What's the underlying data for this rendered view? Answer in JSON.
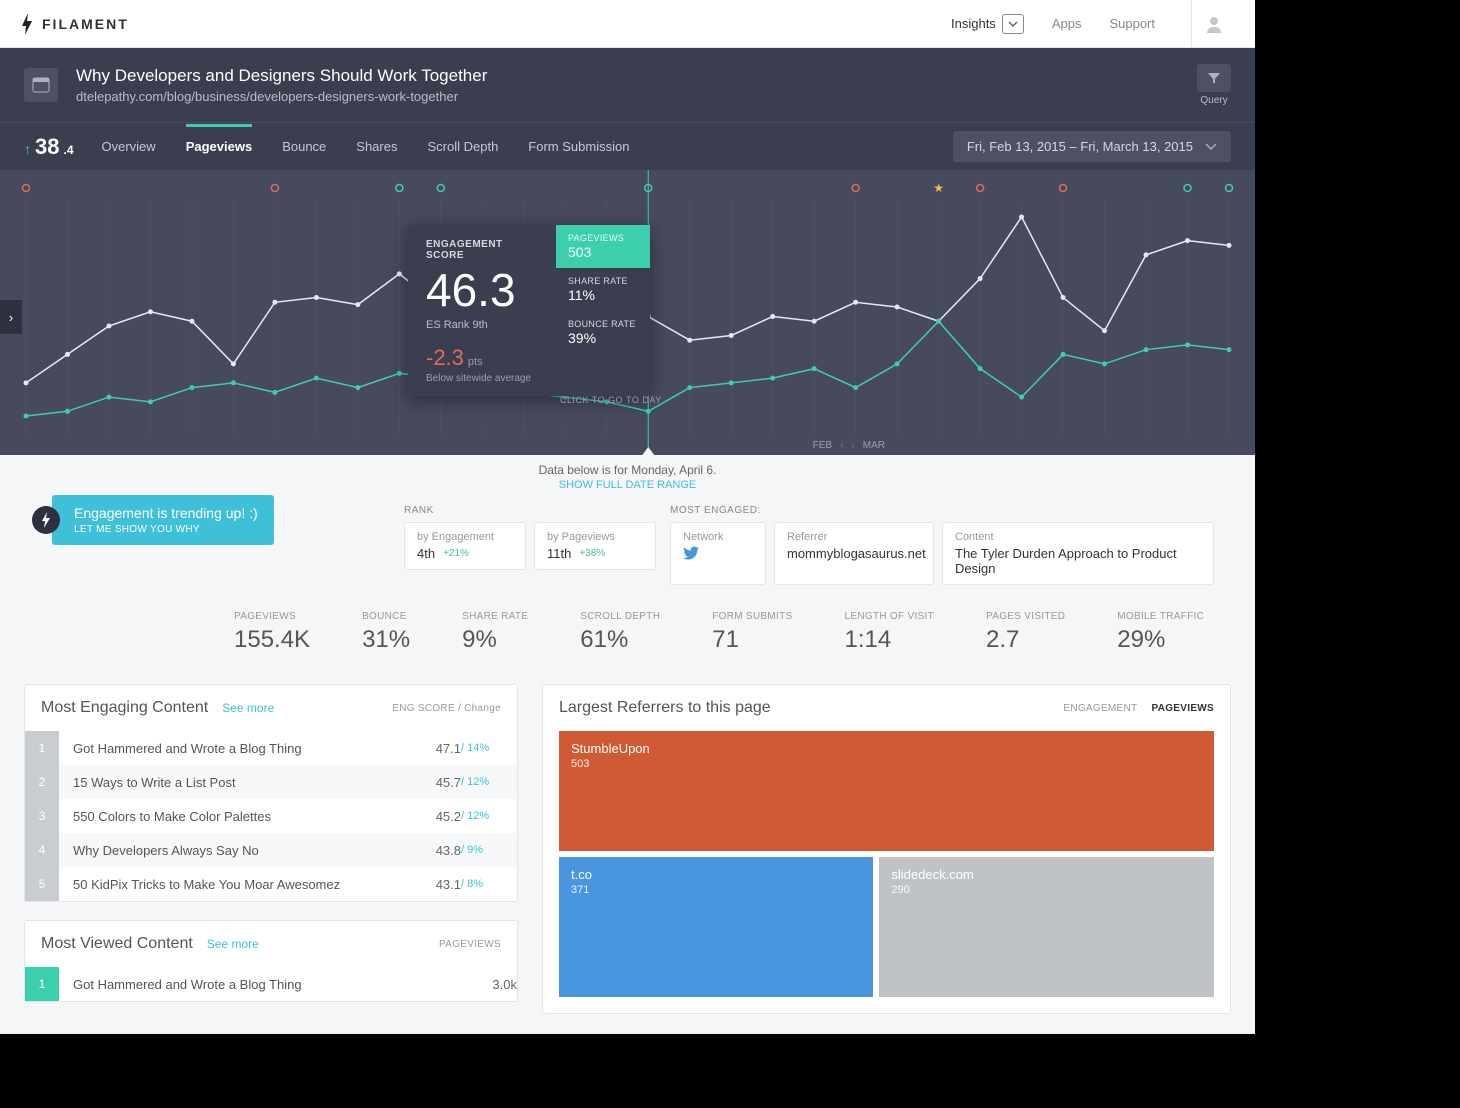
{
  "brand": "FILAMENT",
  "nav": {
    "insights": "Insights",
    "apps": "Apps",
    "support": "Support"
  },
  "page": {
    "title": "Why Developers and Designers Should Work Together",
    "url": "dtelepathy.com/blog/business/developers-designers-work-together",
    "query": "Query"
  },
  "score": {
    "int": "38",
    "dec": ".4"
  },
  "tabs": {
    "overview": "Overview",
    "pageviews": "Pageviews",
    "bounce": "Bounce",
    "shares": "Shares",
    "scroll": "Scroll Depth",
    "form": "Form Submission"
  },
  "daterange": "Fri, Feb 13, 2015 – Fri, March 13, 2015",
  "tooltip": {
    "title": "ENGAGEMENT SCORE",
    "score": "46.3",
    "rank": "ES Rank 9th",
    "delta": "-2.3",
    "delta_unit": "pts",
    "below": "Below sitewide average",
    "pv_lbl": "PAGEVIEWS",
    "pv_val": "503",
    "sr_lbl": "SHARE RATE",
    "sr_val": "11%",
    "br_lbl": "BOUNCE RATE",
    "br_val": "39%",
    "hint": "CLICK TO GO TO DAY"
  },
  "months": {
    "feb": "FEB",
    "mar": "MAR"
  },
  "databar": {
    "text": "Data below is for Monday, April 6.",
    "link": "SHOW FULL DATE RANGE"
  },
  "trend": {
    "t": "Engagement is trending up!  :)",
    "s": "LET ME SHOW YOU WHY"
  },
  "rank": {
    "lbl": "RANK",
    "by_eng_lbl": "by Engagement",
    "by_eng_val": "4th",
    "by_eng_pct": "+21%",
    "by_pv_lbl": "by Pageviews",
    "by_pv_val": "11th",
    "by_pv_pct": "+38%"
  },
  "engaged": {
    "lbl": "MOST ENGAGED:",
    "net_lbl": "Network",
    "ref_lbl": "Referrer",
    "ref_val": "mommyblogasaurus.net",
    "con_lbl": "Content",
    "con_val": "The Tyler Durden Approach to Product Design"
  },
  "metrics": {
    "pv": {
      "l": "PAGEVIEWS",
      "v": "155.4K"
    },
    "bn": {
      "l": "BOUNCE",
      "v": "31%"
    },
    "sr": {
      "l": "SHARE RATE",
      "v": "9%"
    },
    "sd": {
      "l": "SCROLL DEPTH",
      "v": "61%"
    },
    "fs": {
      "l": "FORM SUBMITS",
      "v": "71"
    },
    "lv": {
      "l": "LENGTH OF VISIT",
      "v": "1:14"
    },
    "pvs": {
      "l": "PAGES VISITED",
      "v": "2.7"
    },
    "mt": {
      "l": "MOBILE TRAFFIC",
      "v": "29%"
    }
  },
  "engaging": {
    "title": "Most Engaging Content",
    "more": "See more",
    "meta": "ENG SCORE / Change",
    "rows": [
      {
        "n": "1",
        "t": "Got Hammered and Wrote a Blog Thing",
        "v": "47.1",
        "c": "/ 14%"
      },
      {
        "n": "2",
        "t": "15 Ways to Write a List Post",
        "v": "45.7",
        "c": "/ 12%"
      },
      {
        "n": "3",
        "t": "550 Colors to Make Color Palettes",
        "v": "45.2",
        "c": "/ 12%"
      },
      {
        "n": "4",
        "t": "Why Developers Always Say No",
        "v": "43.8",
        "c": "/ 9%"
      },
      {
        "n": "5",
        "t": "50 KidPix Tricks to Make You Moar Awesomez",
        "v": "43.1",
        "c": "/ 8%"
      }
    ]
  },
  "viewed": {
    "title": "Most Viewed Content",
    "more": "See more",
    "meta": "PAGEVIEWS",
    "rows": [
      {
        "n": "1",
        "t": "Got Hammered and Wrote a Blog Thing",
        "v": "3.0k"
      }
    ]
  },
  "referrers": {
    "title": "Largest Referrers to this page",
    "tab_eng": "ENGAGEMENT",
    "tab_pv": "PAGEVIEWS",
    "items": [
      {
        "name": "StumbleUpon",
        "val": "503"
      },
      {
        "name": "t.co",
        "val": "371"
      },
      {
        "name": "slidedeck.com",
        "val": "290"
      }
    ]
  },
  "chart_data": {
    "type": "line",
    "x_days": 29,
    "series": [
      {
        "name": "Engagement",
        "color": "#e8e9ef",
        "values": [
          22,
          34,
          46,
          52,
          48,
          30,
          56,
          58,
          55,
          68,
          54,
          70,
          64,
          62,
          58,
          50,
          40,
          42,
          50,
          48,
          56,
          54,
          48,
          66,
          92,
          58,
          44,
          76,
          82,
          80
        ]
      },
      {
        "name": "Pageviews",
        "color": "#3ccfae",
        "values": [
          8,
          10,
          16,
          14,
          20,
          22,
          18,
          24,
          20,
          26,
          24,
          22,
          18,
          16,
          14,
          10,
          20,
          22,
          24,
          28,
          20,
          30,
          48,
          28,
          16,
          34,
          30,
          36,
          38,
          36
        ]
      }
    ],
    "ylim": [
      0,
      100
    ],
    "markers": [
      {
        "x": 0,
        "type": "ring",
        "color": "#e06b5d"
      },
      {
        "x": 6,
        "type": "ring",
        "color": "#e06b5d"
      },
      {
        "x": 9,
        "type": "ring",
        "color": "#3ccfae"
      },
      {
        "x": 10,
        "type": "ring",
        "color": "#3ccfae"
      },
      {
        "x": 15,
        "type": "ring",
        "color": "#3ccfae"
      },
      {
        "x": 20,
        "type": "ring",
        "color": "#e06b5d"
      },
      {
        "x": 22,
        "type": "star",
        "color": "#f3c04b"
      },
      {
        "x": 23,
        "type": "ring",
        "color": "#e06b5d"
      },
      {
        "x": 25,
        "type": "ring",
        "color": "#e06b5d"
      },
      {
        "x": 28,
        "type": "ring",
        "color": "#3ccfae"
      },
      {
        "x": 29,
        "type": "ring",
        "color": "#3ccfae"
      }
    ],
    "highlight_x": 15
  }
}
